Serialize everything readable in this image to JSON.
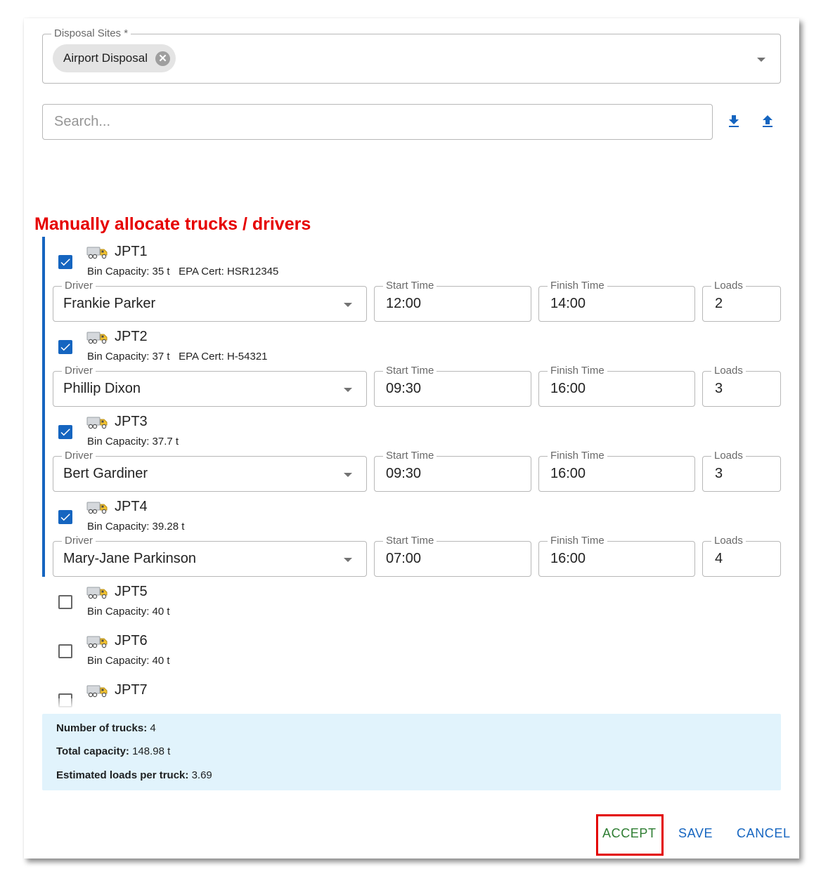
{
  "disposal": {
    "label": "Disposal Sites *",
    "chip": "Airport Disposal"
  },
  "search": {
    "placeholder": "Search..."
  },
  "icons": {
    "download": "download-icon",
    "upload": "upload-icon",
    "truck": "truck-icon"
  },
  "colors": {
    "primary": "#1565c0",
    "accept": "#2e7d32",
    "annotation": "#e60000",
    "summary_bg": "#e1f3fc"
  },
  "section_title": "Manually allocate trucks / drivers",
  "field_labels": {
    "driver": "Driver",
    "start": "Start Time",
    "finish": "Finish Time",
    "loads": "Loads"
  },
  "trucks": [
    {
      "name": "JPT1",
      "checked": true,
      "info": "Bin Capacity: 35 t   EPA Cert: HSR12345",
      "driver": "Frankie Parker",
      "start": "12:00",
      "finish": "14:00",
      "loads": "2"
    },
    {
      "name": "JPT2",
      "checked": true,
      "info": "Bin Capacity: 37 t   EPA Cert: H-54321",
      "driver": "Phillip Dixon",
      "start": "09:30",
      "finish": "16:00",
      "loads": "3"
    },
    {
      "name": "JPT3",
      "checked": true,
      "info": "Bin Capacity: 37.7 t",
      "driver": "Bert Gardiner",
      "start": "09:30",
      "finish": "16:00",
      "loads": "3"
    },
    {
      "name": "JPT4",
      "checked": true,
      "info": "Bin Capacity: 39.28 t",
      "driver": "Mary-Jane Parkinson",
      "start": "07:00",
      "finish": "16:00",
      "loads": "4"
    },
    {
      "name": "JPT5",
      "checked": false,
      "info": "Bin Capacity: 40 t"
    },
    {
      "name": "JPT6",
      "checked": false,
      "info": "Bin Capacity: 40 t"
    },
    {
      "name": "JPT7",
      "checked": false
    }
  ],
  "summary": {
    "trucks_label": "Number of trucks:",
    "trucks_value": "4",
    "capacity_label": "Total capacity:",
    "capacity_value": "148.98 t",
    "loads_label": "Estimated loads per truck:",
    "loads_value": "3.69"
  },
  "actions": {
    "accept": "ACCEPT",
    "save": "SAVE",
    "cancel": "CANCEL"
  }
}
